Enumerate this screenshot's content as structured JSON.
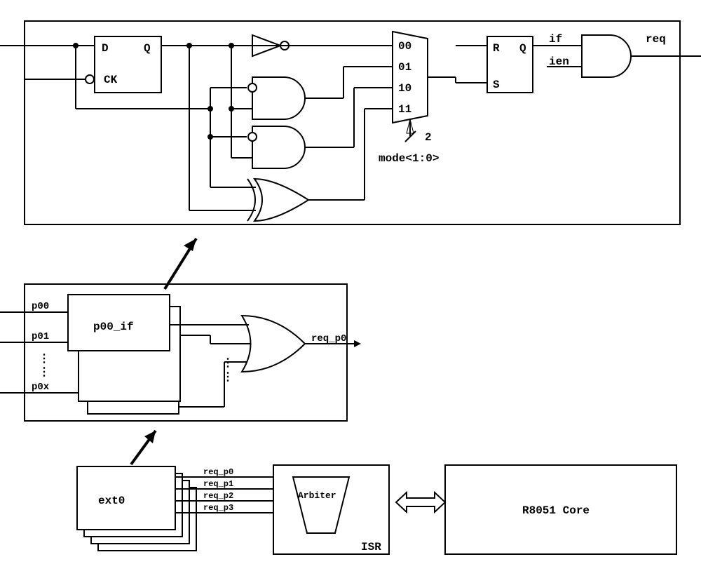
{
  "top": {
    "ff": {
      "D": "D",
      "Q": "Q",
      "CK": "CK"
    },
    "mux": {
      "i0": "00",
      "i1": "01",
      "i2": "10",
      "i3": "11",
      "sel_label": "mode<1:0>",
      "sel_width": "2"
    },
    "latch": {
      "R": "R",
      "Q": "Q",
      "S": "S"
    },
    "and": {
      "a": "if",
      "b": "ien"
    },
    "out": "req"
  },
  "mid": {
    "p00": "p00",
    "p01": "p01",
    "p0x": "p0x",
    "block_label": "p00_if",
    "out": "req_p0"
  },
  "bottom": {
    "ext0": "ext0",
    "req_p0": "req_p0",
    "req_p1": "req_p1",
    "req_p2": "req_p2",
    "req_p3": "req_p3",
    "arbiter": "Arbiter",
    "isr": "ISR",
    "core": "R8051 Core"
  }
}
